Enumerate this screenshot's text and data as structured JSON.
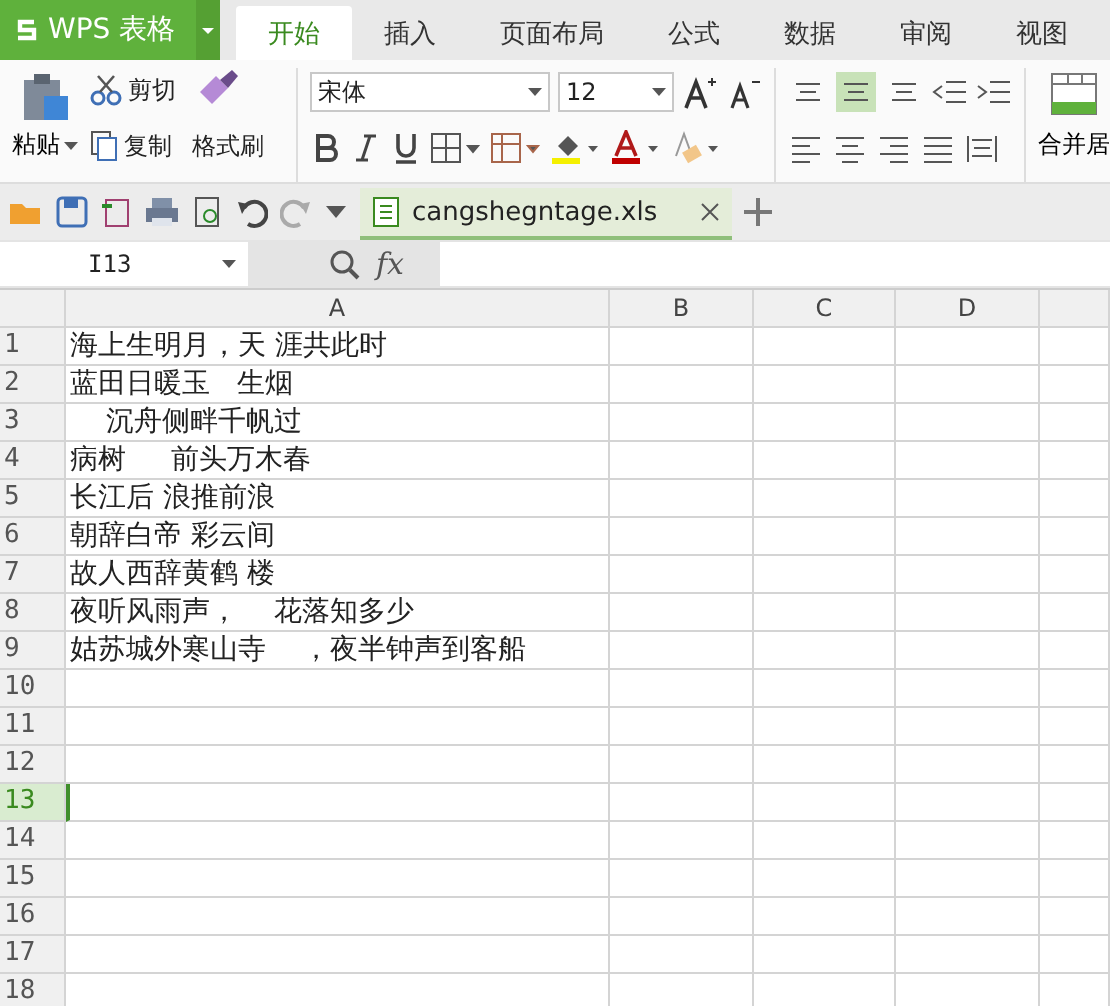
{
  "app": {
    "brand": "WPS 表格"
  },
  "tabs": [
    {
      "label": "开始",
      "selected": true
    },
    {
      "label": "插入",
      "selected": false
    },
    {
      "label": "页面布局",
      "selected": false
    },
    {
      "label": "公式",
      "selected": false
    },
    {
      "label": "数据",
      "selected": false
    },
    {
      "label": "审阅",
      "selected": false
    },
    {
      "label": "视图",
      "selected": false
    }
  ],
  "clipboard": {
    "paste": "粘贴",
    "cut": "剪切",
    "copy": "复制",
    "format_painter": "格式刷"
  },
  "font": {
    "family": "宋体",
    "size": "12"
  },
  "align_buttons": [
    {
      "selected": false
    },
    {
      "selected": true
    },
    {
      "selected": false
    }
  ],
  "merge": {
    "label": "合并居"
  },
  "document_tab": {
    "name": "cangshegntage.xls"
  },
  "formula_bar": {
    "cell": "I13",
    "fx": "fx"
  },
  "columns": [
    "A",
    "B",
    "C",
    "D"
  ],
  "rows": [
    {
      "number": "1",
      "selected": false,
      "text": "海上生明月，天 涯共此时"
    },
    {
      "number": "2",
      "selected": false,
      "text": "蓝田日暖玉   生烟"
    },
    {
      "number": "3",
      "selected": false,
      "text": "    沉舟侧畔千帆过"
    },
    {
      "number": "4",
      "selected": false,
      "text": "病树     前头万木春"
    },
    {
      "number": "5",
      "selected": false,
      "text": "长江后 浪推前浪"
    },
    {
      "number": "6",
      "selected": false,
      "text": "朝辞白帝 彩云间"
    },
    {
      "number": "7",
      "selected": false,
      "text": "故人西辞黄鹤 楼"
    },
    {
      "number": "8",
      "selected": false,
      "text": "夜听风雨声，    花落知多少"
    },
    {
      "number": "9",
      "selected": false,
      "text": "姑苏城外寒山寺    ，夜半钟声到客船"
    },
    {
      "number": "10",
      "selected": false
    },
    {
      "number": "11",
      "selected": false
    },
    {
      "number": "12",
      "selected": false
    },
    {
      "number": "13",
      "selected": true
    },
    {
      "number": "14",
      "selected": false
    },
    {
      "number": "15",
      "selected": false
    },
    {
      "number": "16",
      "selected": false
    },
    {
      "number": "17",
      "selected": false
    },
    {
      "number": "18",
      "selected": false
    }
  ]
}
